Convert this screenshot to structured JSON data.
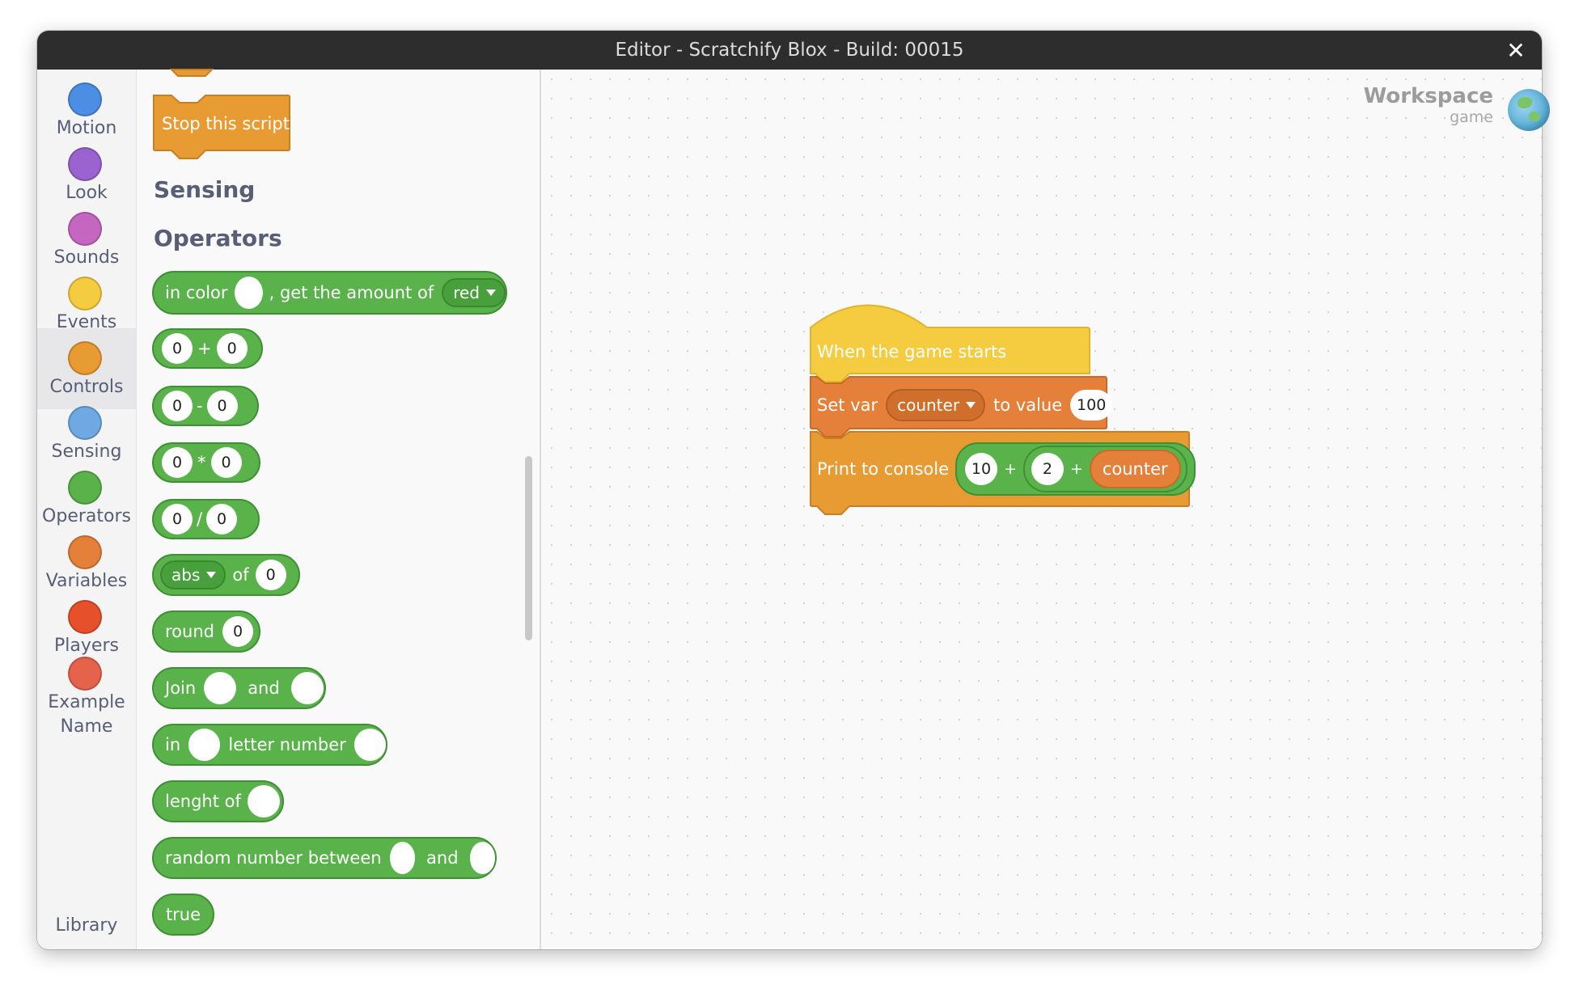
{
  "window": {
    "title": "Editor - Scratchify Blox - Build: 00015"
  },
  "categories": [
    {
      "label": "Motion",
      "color": "#4c8ee3"
    },
    {
      "label": "Look",
      "color": "#9a63cf"
    },
    {
      "label": "Sounds",
      "color": "#c566c0"
    },
    {
      "label": "Events",
      "color": "#f5cc3f"
    },
    {
      "label": "Controls",
      "color": "#e89b33"
    },
    {
      "label": "Sensing",
      "color": "#6ea9e3"
    },
    {
      "label": "Operators",
      "color": "#59b24a"
    },
    {
      "label": "Variables",
      "color": "#e5803a"
    },
    {
      "label": "Players",
      "color": "#e6512b"
    },
    {
      "label": "Example\nName",
      "color": "#e5634a"
    }
  ],
  "active_category": "Controls",
  "library_label": "Library",
  "palette": {
    "stop_block": "Stop this script",
    "sensing_header": "Sensing",
    "operators_header": "Operators",
    "color_block": {
      "prefix": "in color",
      "middle": ", get the amount of",
      "dropdown": "red"
    },
    "add_block": {
      "a": "0",
      "op": "+",
      "b": "0"
    },
    "sub_block": {
      "a": "0",
      "op": "-",
      "b": "0"
    },
    "mul_block": {
      "a": "0",
      "op": "*",
      "b": "0"
    },
    "div_block": {
      "a": "0",
      "op": "/",
      "b": "0"
    },
    "abs_block": {
      "dropdown": "abs",
      "of": "of",
      "value": "0"
    },
    "round_block": {
      "label": "round",
      "value": "0"
    },
    "join_block": {
      "label": "Join",
      "and": "and"
    },
    "letter_block": {
      "in": "in",
      "label": "letter number"
    },
    "length_block": {
      "label": "lenght of"
    },
    "random_block": {
      "label": "random number between",
      "and": "and"
    },
    "true_block": {
      "label": "true"
    }
  },
  "workspace": {
    "title": "Workspace",
    "subtitle": "game",
    "script": {
      "hat": "When the game starts",
      "set_var": {
        "label": "Set var",
        "variable": "counter",
        "to_value": "to value",
        "value": "100"
      },
      "print": {
        "label": "Print to console",
        "a": "10",
        "op1": "+",
        "b": "2",
        "op2": "+",
        "var": "counter"
      }
    }
  },
  "colors": {
    "controls": "#e89b33",
    "events": "#f5cc3f",
    "variables": "#e5803a",
    "operators": "#59b24a"
  }
}
